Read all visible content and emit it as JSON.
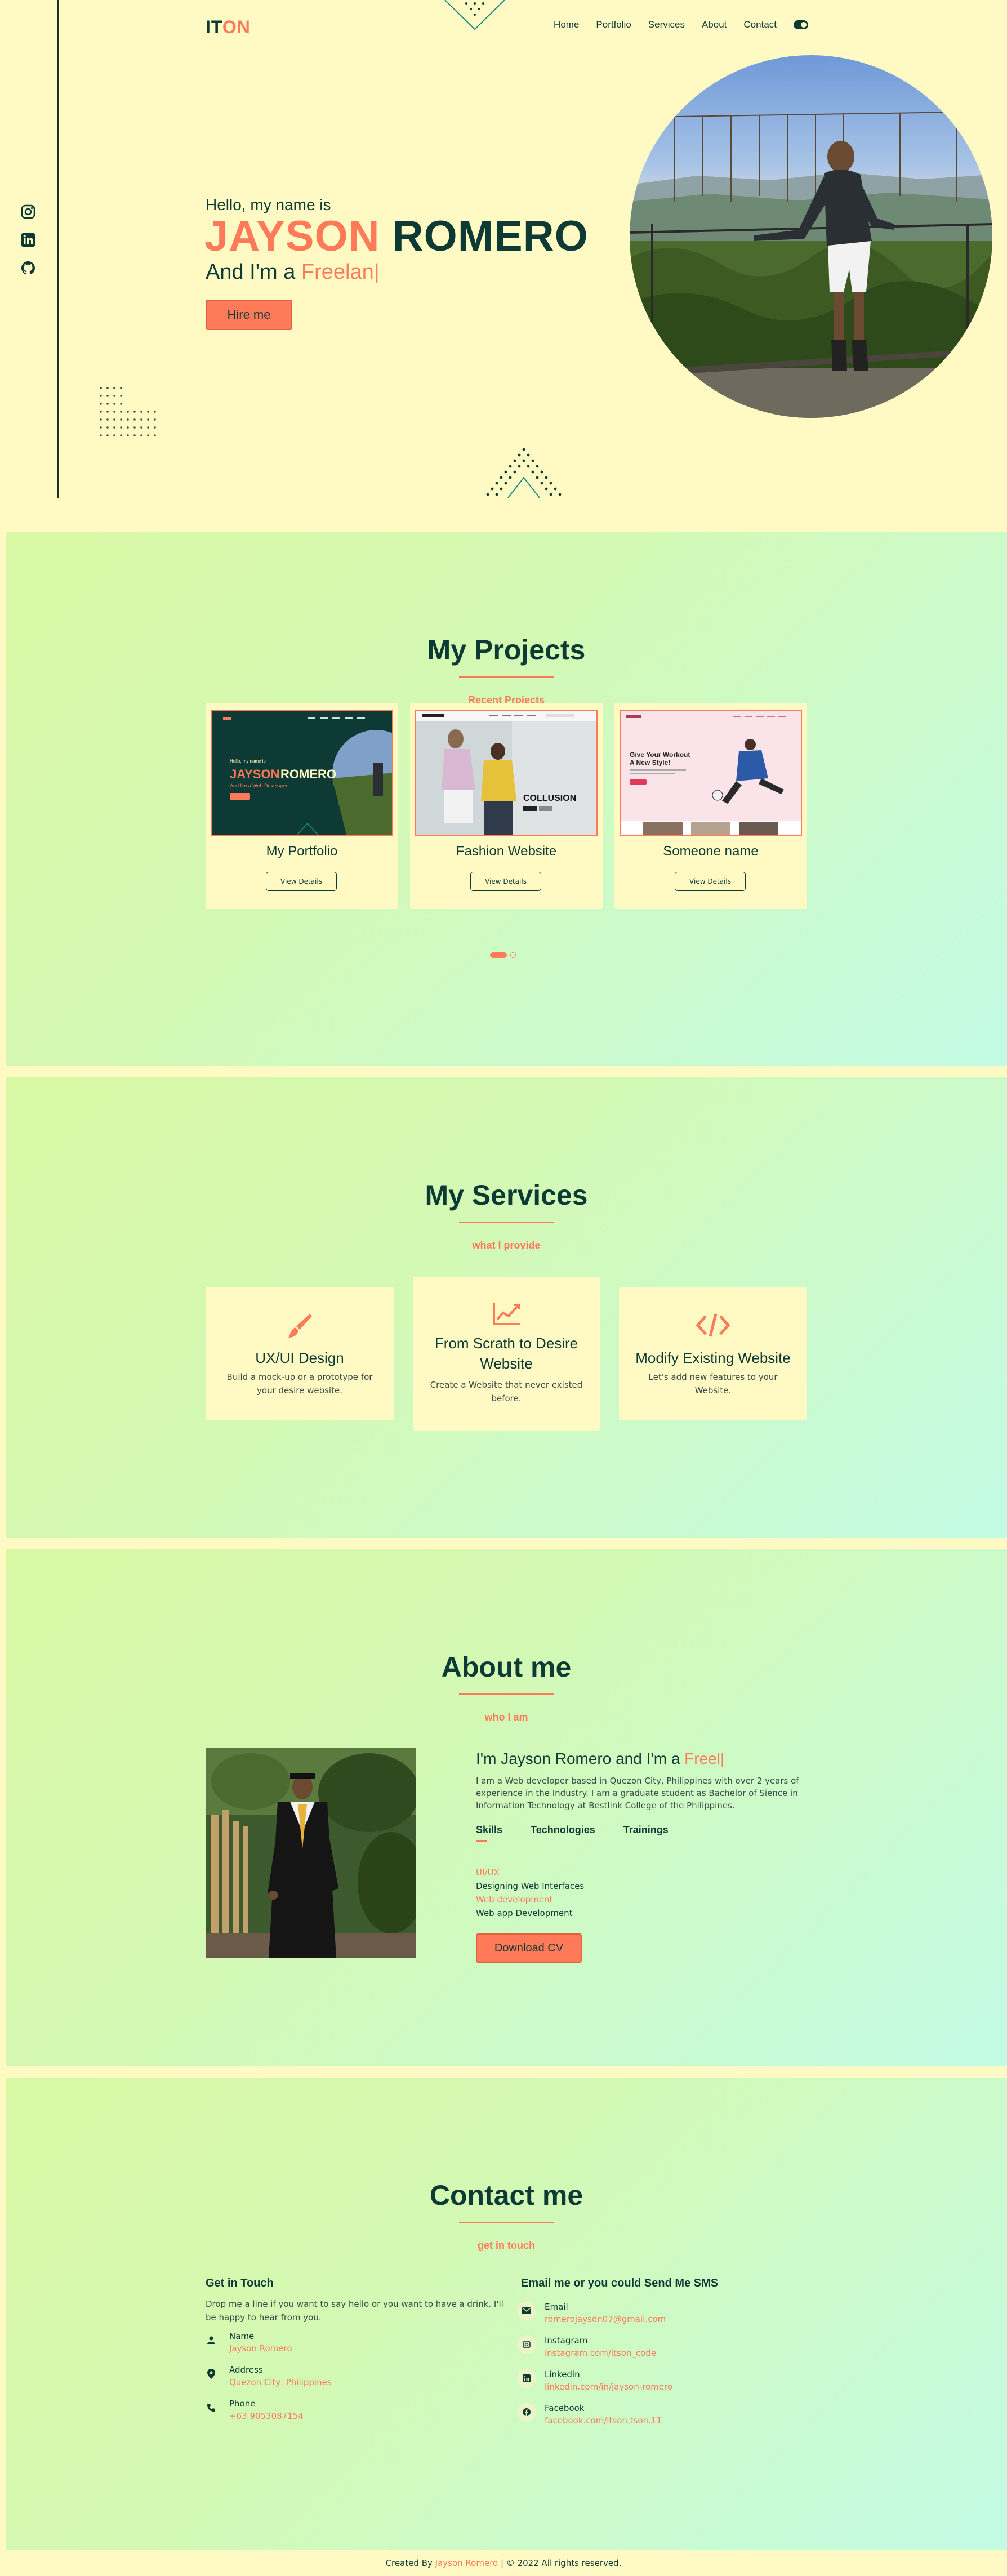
{
  "nav": {
    "logo_a": "IT",
    "logo_b": "ON",
    "links": [
      "Home",
      "Portfolio",
      "Services",
      "About",
      "Contact"
    ]
  },
  "hero": {
    "greeting": "Hello, my name is",
    "first_name": "JAYSON",
    "last_name": "ROMERO",
    "im_a": "And I'm a",
    "typed": "Freelan|",
    "cta": "Hire me",
    "social_icons": [
      "instagram-icon",
      "linkedin-icon",
      "github-icon"
    ]
  },
  "projects": {
    "title": "My Projects",
    "subtitle": "Recent Projects",
    "items": [
      {
        "title": "My Portfolio",
        "button": "View Details"
      },
      {
        "title": "Fashion Website",
        "button": "View Details"
      },
      {
        "title": "Someone name",
        "button": "View Details"
      }
    ],
    "thumb_text": {
      "p1_hello": "Hello, my name is",
      "p1_name_a": "JAYSON",
      "p1_name_b": "ROMERO",
      "p1_role": "And I'm a Web Developer",
      "p2_brand": "COLLUSION",
      "p3_head_a": "Give Your Workout",
      "p3_head_b": "A New Style!"
    }
  },
  "services": {
    "title": "My Services",
    "subtitle": "what I provide",
    "items": [
      {
        "title": "UX/UI Design",
        "desc": "Build a mock-up or a prototype for your desire website."
      },
      {
        "title": "From Scrath to Desire Website",
        "desc": "Create a Website that never existed before."
      },
      {
        "title": "Modify Existing Website",
        "desc": "Let's add new features to your Website."
      }
    ]
  },
  "about": {
    "title": "About me",
    "subtitle": "who I am",
    "heading": "I'm Jayson Romero and I'm a",
    "heading_typed": "Freel|",
    "text": "I am a Web developer based in Quezon City, Philippines with over 2 years of experience in the Industry. I am a graduate student as Bachelor of Sience in Information Technology at Bestlink College of the Philippines.",
    "tabs": [
      "Skills",
      "Technologies",
      "Trainings"
    ],
    "skills": [
      {
        "name": "UI/UX",
        "detail": "Designing Web Interfaces"
      },
      {
        "name": "Web development",
        "detail": "Web app Development"
      }
    ],
    "cv_button": "Download CV"
  },
  "contact": {
    "title": "Contact me",
    "subtitle": "get in touch",
    "left_heading": "Get in Touch",
    "intro": "Drop me a line if you want to say hello or you want to have a drink. I'll be happy to hear from you.",
    "details": [
      {
        "label": "Name",
        "value": "Jayson Romero",
        "icon": "user-icon"
      },
      {
        "label": "Address",
        "value": "Quezon City, Philippines",
        "icon": "location-icon"
      },
      {
        "label": "Phone",
        "value": "+63 9053087154",
        "icon": "phone-icon"
      }
    ],
    "right_heading": "Email me or you could Send Me SMS",
    "links": [
      {
        "label": "Email",
        "value": "romerojayson07@gmail.com",
        "icon": "envelope-icon"
      },
      {
        "label": "Instagram",
        "value": "instagram.com/itson_code",
        "icon": "instagram-icon"
      },
      {
        "label": "Linkedin",
        "value": "linkedin.com/in/jayson-romero",
        "icon": "linkedin-icon"
      },
      {
        "label": "Facebook",
        "value": "facebook.com/itson.tson.11",
        "icon": "facebook-icon"
      }
    ]
  },
  "footer": {
    "prefix": "Created By",
    "name": "Jayson Romero",
    "suffix": "| © 2022 All rights reserved."
  },
  "colors": {
    "accent": "#ff7a59",
    "dark": "#0e3a35",
    "cream": "#fffac3",
    "gradient_start": "#daf9a5",
    "gradient_end": "#c2fbe4"
  }
}
